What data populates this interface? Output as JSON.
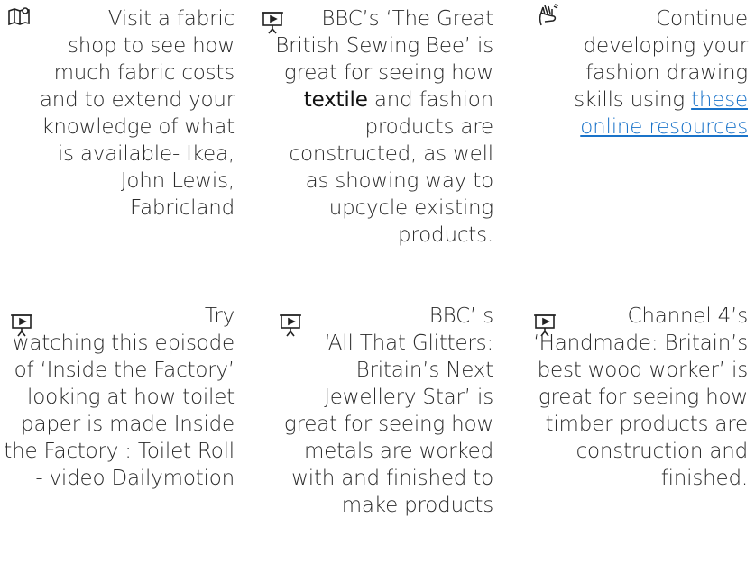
{
  "cards": [
    {
      "icon": "map-icon",
      "text": "Visit a fabric shop to see how much fabric costs and to extend your knowledge of what is available- Ikea, John Lewis, Fabricland"
    },
    {
      "icon": "presentation-icon",
      "text_before": "BBC’s ‘The Great British Sewing Bee’ is great for seeing how ",
      "emphasis": "textile",
      "text_after": " and fashion products are constructed, as well as showing way to upcycle existing products."
    },
    {
      "icon": "sign-language-icon",
      "text_before": "Continue developing your fashion drawing skills using ",
      "link_text": "these online resources"
    },
    {
      "icon": "presentation-icon",
      "text": "Try watching this episode of ‘Inside the Factory’ looking at how toilet paper is made Inside the Factory : Toilet Roll - video Dailymotion"
    },
    {
      "icon": "presentation-icon",
      "text": "BBC’ s ‘All That Glitters: Britain’s Next Jewellery Star’ is great for seeing how metals are worked with and finished to make products"
    },
    {
      "icon": "presentation-icon",
      "text": "Channel 4’s ‘Handmade: Britain’s best wood worker’ is great for seeing how timber products are construction and finished."
    }
  ]
}
